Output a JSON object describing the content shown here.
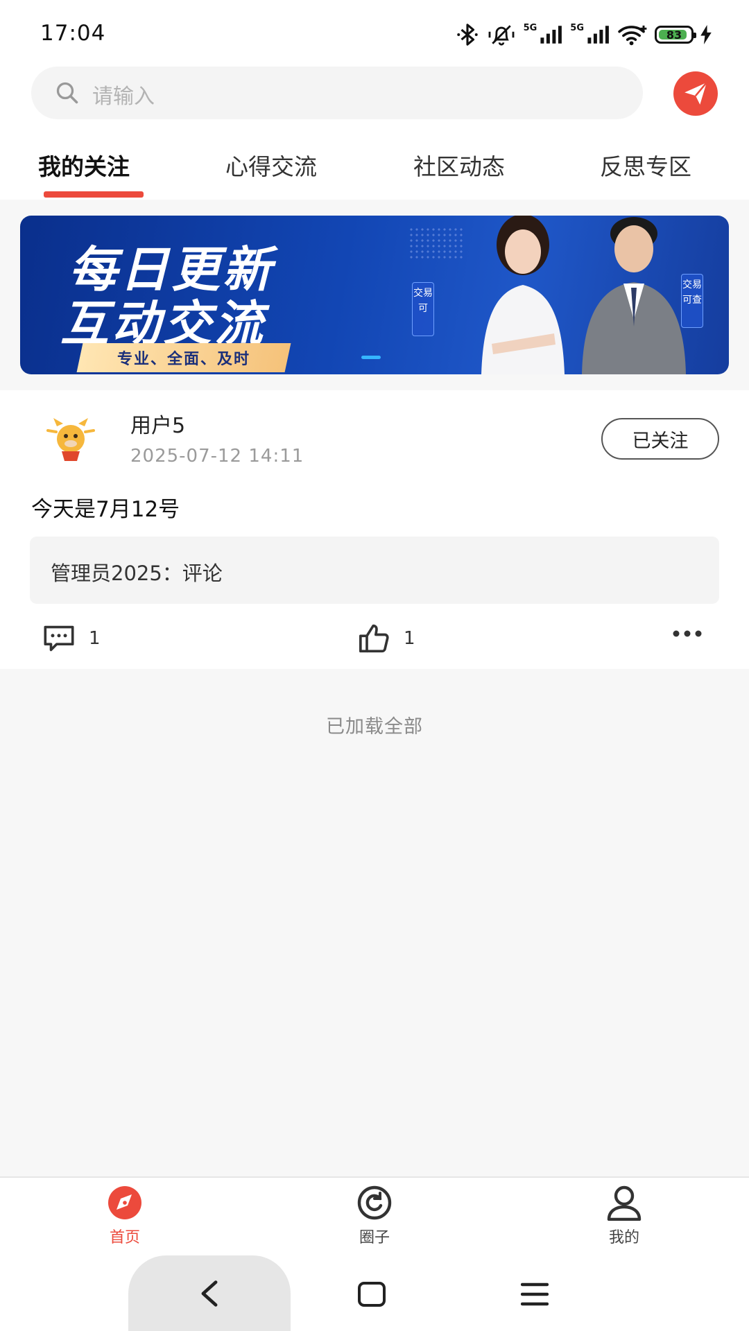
{
  "status_bar": {
    "time": "17:04",
    "network_label_1": "5G",
    "network_label_2": "5G",
    "battery_level": "83",
    "icons": [
      "bluetooth-icon",
      "mute-icon",
      "signal-icon",
      "signal-icon",
      "wifi-icon",
      "battery-icon",
      "charging-icon"
    ]
  },
  "search": {
    "placeholder": "请输入",
    "icon": "search-icon",
    "action_icon": "send-icon"
  },
  "tabs": [
    {
      "label": "我的关注",
      "active": true
    },
    {
      "label": "心得交流",
      "active": false
    },
    {
      "label": "社区动态",
      "active": false
    },
    {
      "label": "反思专区",
      "active": false
    }
  ],
  "banner": {
    "line1": "每日更新",
    "line2": "互动交流",
    "tagline": "专业、全面、及时",
    "badge_left": "交易可",
    "badge_right": "交易可查"
  },
  "post": {
    "user_name": "用户5",
    "time": "2025-07-12 14:11",
    "follow_label": "已关注",
    "content": "今天是7月12号",
    "comment_text": "管理员2025：评论",
    "comment_count": "1",
    "like_count": "1"
  },
  "feed": {
    "end_text": "已加载全部"
  },
  "bottom_nav": [
    {
      "label": "首页",
      "icon": "compass-icon",
      "active": true
    },
    {
      "label": "圈子",
      "icon": "circle-refresh-icon",
      "active": false
    },
    {
      "label": "我的",
      "icon": "user-icon",
      "active": false
    }
  ],
  "colors": {
    "accent": "#ec4a3c",
    "banner_blue": "#1246b4",
    "background": "#f7f7f7"
  }
}
